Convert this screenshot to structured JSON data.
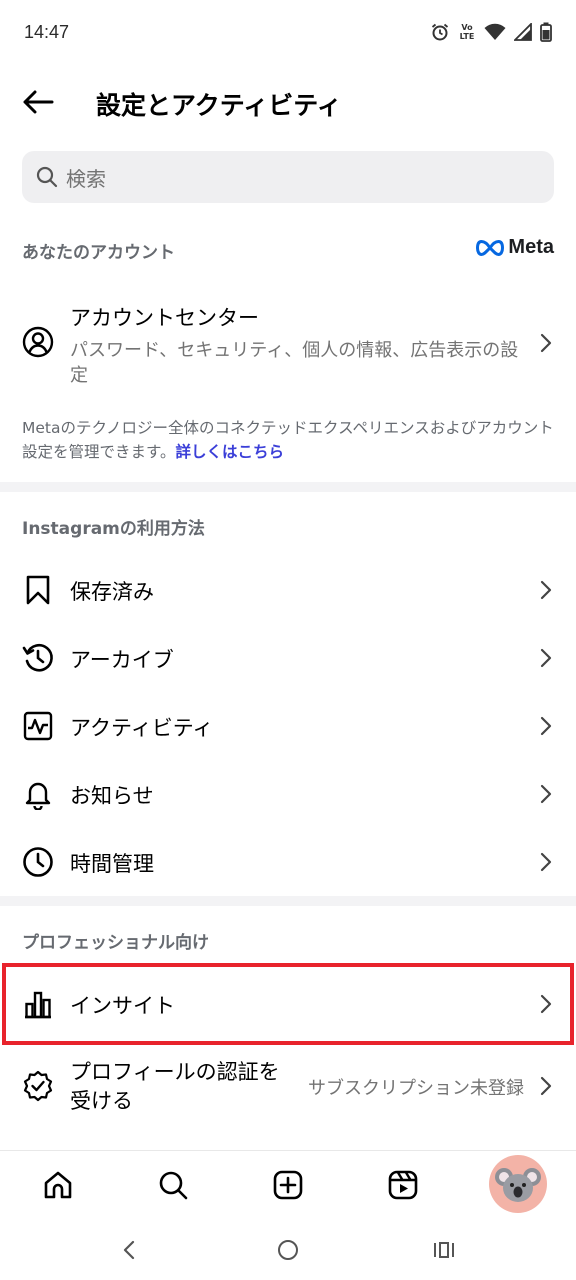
{
  "status_bar": {
    "time": "14:47",
    "volte_label": "Vo LTE"
  },
  "header": {
    "title": "設定とアクティビティ"
  },
  "search": {
    "placeholder": "検索"
  },
  "account_section": {
    "label": "あなたのアカウント",
    "brand": "Meta",
    "brand_color": "#0668E1",
    "account_center": {
      "title": "アカウントセンター",
      "subtitle": "パスワード、セキュリティ、個人の情報、広告表示の設定"
    },
    "note": "Metaのテクノロジー全体のコネクテッドエクスペリエンスおよびアカウント設定を管理できます。",
    "note_link": "詳しくはこちら",
    "link_color": "#3b3fd8"
  },
  "usage_section": {
    "label": "Instagramの利用方法",
    "items": [
      {
        "label": "保存済み",
        "icon": "bookmark-icon"
      },
      {
        "label": "アーカイブ",
        "icon": "archive-history-icon"
      },
      {
        "label": "アクティビティ",
        "icon": "activity-icon"
      },
      {
        "label": "お知らせ",
        "icon": "bell-icon"
      },
      {
        "label": "時間管理",
        "icon": "clock-icon"
      }
    ]
  },
  "pro_section": {
    "label": "プロフェッショナル向け",
    "insights": {
      "label": "インサイト",
      "icon": "bar-chart-icon"
    },
    "verification": {
      "label": "プロフィールの認証を受ける",
      "value": "サブスクリプション未登録",
      "icon": "verified-badge-icon"
    },
    "highlight_color": "#e8232c"
  },
  "bottom_nav": {
    "items": [
      "home-icon",
      "search-icon",
      "create-icon",
      "reels-icon",
      "profile-avatar"
    ]
  }
}
